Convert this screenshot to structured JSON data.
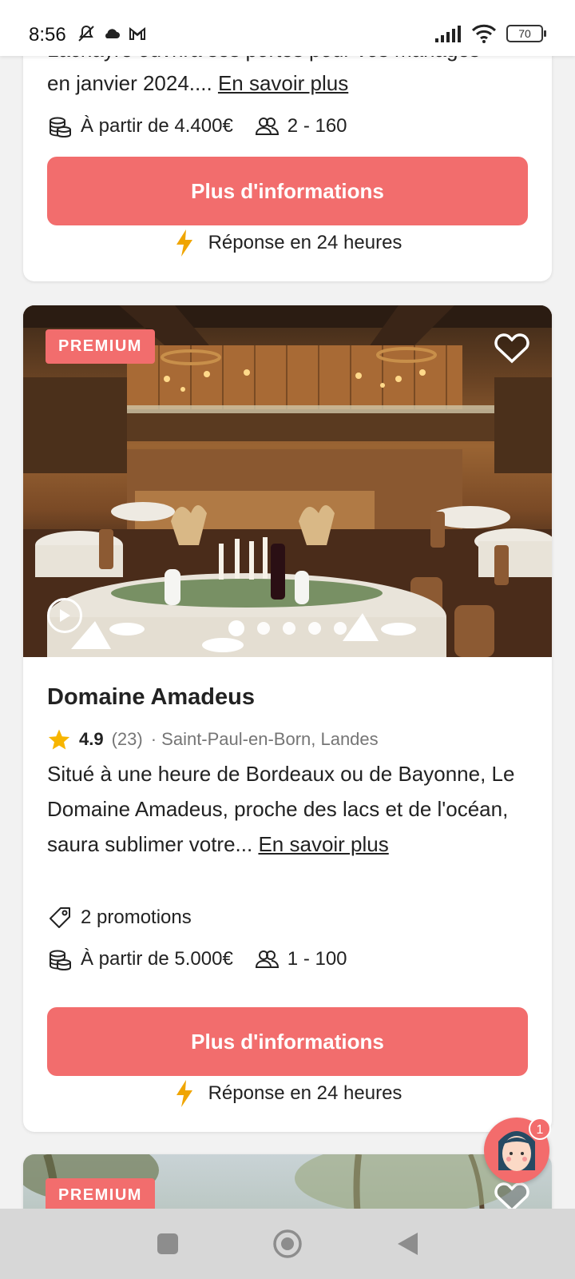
{
  "status_bar": {
    "time": "8:56",
    "battery": "70"
  },
  "cards": [
    {
      "description_fragment": "Lacnayre ouvrira ses portes pour vos mariages",
      "description": "en janvier 2024....",
      "more_link": "En savoir plus",
      "price": "À partir de 4.400€",
      "capacity": "2 - 160",
      "cta": "Plus d'informations",
      "response": "Réponse en 24 heures"
    },
    {
      "badge": "PREMIUM",
      "image_dots": 5,
      "active_dot": 0,
      "title": "Domaine Amadeus",
      "rating": "4.9",
      "reviews": "(23)",
      "location": "· Saint-Paul-en-Born, Landes",
      "description": "Situé à une heure de Bordeaux ou de Bayonne, Le Domaine Amadeus, proche des lacs et de l'océan, saura sublimer votre...",
      "more_link": "En savoir plus",
      "promotions": "2 promotions",
      "price": "À partir de 5.000€",
      "capacity": "1 - 100",
      "cta": "Plus d'informations",
      "response": "Réponse en 24 heures"
    },
    {
      "badge": "PREMIUM"
    }
  ],
  "chat": {
    "badge_count": "1"
  },
  "colors": {
    "accent": "#f26d6d",
    "lightning": "#f0a500",
    "star": "#f7b500"
  }
}
